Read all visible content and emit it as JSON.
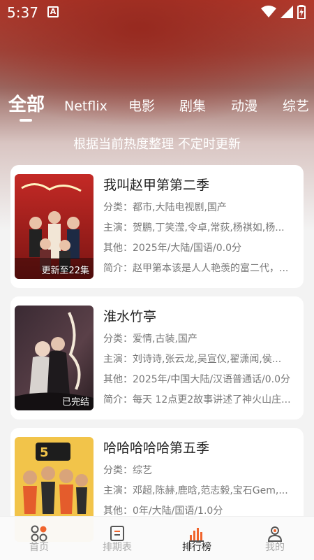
{
  "status_bar": {
    "time": "5:37",
    "notification_glyph": "A"
  },
  "tabs": [
    {
      "label": "全部",
      "active": true
    },
    {
      "label": "Netflix"
    },
    {
      "label": "电影"
    },
    {
      "label": "剧集"
    },
    {
      "label": "动漫"
    },
    {
      "label": "综艺"
    }
  ],
  "subtitle": "根据当前热度整理 不定时更新",
  "cards": [
    {
      "title": "我叫赵甲第第二季",
      "badge": "更新至22集",
      "category": "分类：都市,大陆电视剧,国产",
      "cast": "主演：贺鹏,丁笑滢,令卓,常荻,杨祺如,杨...",
      "other": "其他：2025年/大陆/国语/0.0分",
      "intro": "简介：赵甲第本该是人人艳羡的富二代，..."
    },
    {
      "title": "淮水竹亭",
      "badge": "已完结",
      "category": "分类：爱情,古装,国产",
      "cast": "主演：刘诗诗,张云龙,吴宣仪,翟潇闻,侯...",
      "other": "其他：2025年/中国大陆/汉语普通话/0.0分",
      "intro": "简介：每天 12点更2故事讲述了神火山庄..."
    },
    {
      "title": "哈哈哈哈哈第五季",
      "badge": "",
      "category": "分类：综艺",
      "cast": "主演：邓超,陈赫,鹿晗,范志毅,宝石Gem,...",
      "other": "其他：0年/大陆/国语/1.0分",
      "intro": ""
    }
  ],
  "bottom_nav": [
    {
      "label": "首页",
      "icon": "home-grid-icon"
    },
    {
      "label": "排期表",
      "icon": "schedule-icon"
    },
    {
      "label": "排行榜",
      "icon": "ranking-chart-icon",
      "active": true
    },
    {
      "label": "我的",
      "icon": "profile-icon"
    }
  ],
  "colors": {
    "accent": "#f0642c",
    "hero": "#b53a2c"
  }
}
